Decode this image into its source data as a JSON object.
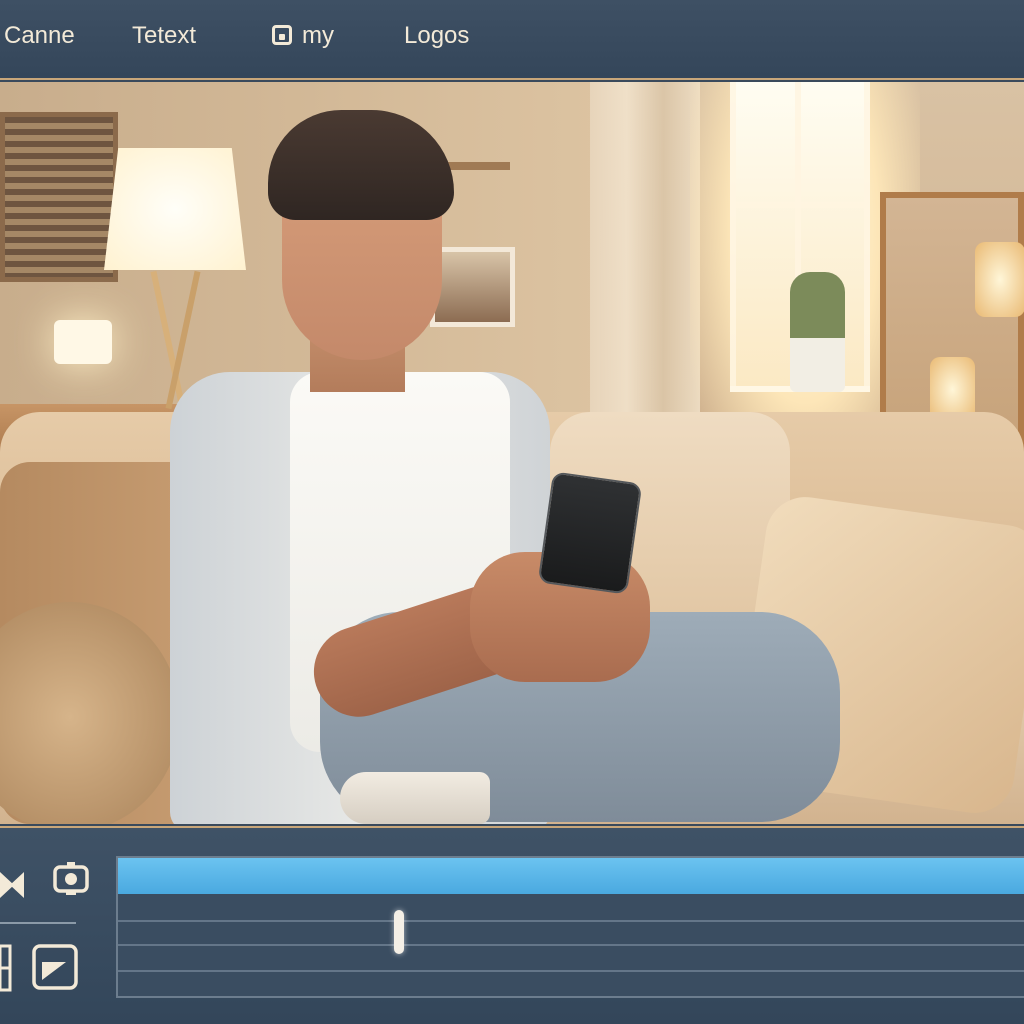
{
  "menu": {
    "items": [
      {
        "label": "Canne",
        "icon": ""
      },
      {
        "label": "Tetext",
        "icon": ""
      },
      {
        "label": "my",
        "icon": "square-target-icon"
      },
      {
        "label": "Logos",
        "icon": ""
      }
    ]
  },
  "viewer": {
    "content": "3d-render-image"
  },
  "toolbar": {
    "icons": [
      "play-skip-icon",
      "camera-icon",
      "grid-icon",
      "frame-icon"
    ]
  },
  "timeline": {
    "playhead_fraction": 0.31
  },
  "colors": {
    "panel": "#3a4a5c",
    "accent_bar": "#5bb8ec",
    "border": "#c9a77a"
  }
}
